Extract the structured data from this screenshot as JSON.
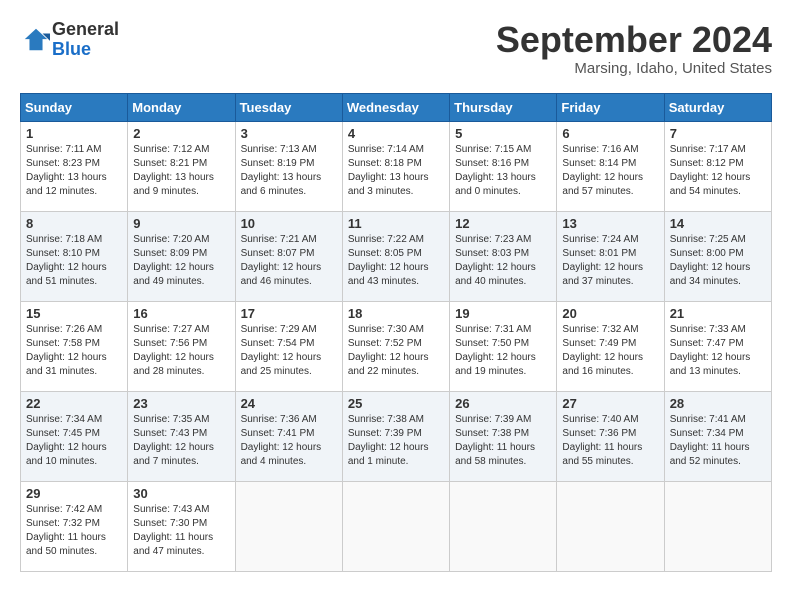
{
  "header": {
    "logo": {
      "line1": "General",
      "line2": "Blue"
    },
    "title": "September 2024",
    "location": "Marsing, Idaho, United States"
  },
  "days_of_week": [
    "Sunday",
    "Monday",
    "Tuesday",
    "Wednesday",
    "Thursday",
    "Friday",
    "Saturday"
  ],
  "weeks": [
    [
      {
        "day": 1,
        "sunrise": "7:11 AM",
        "sunset": "8:23 PM",
        "daylight": "13 hours and 12 minutes"
      },
      {
        "day": 2,
        "sunrise": "7:12 AM",
        "sunset": "8:21 PM",
        "daylight": "13 hours and 9 minutes"
      },
      {
        "day": 3,
        "sunrise": "7:13 AM",
        "sunset": "8:19 PM",
        "daylight": "13 hours and 6 minutes"
      },
      {
        "day": 4,
        "sunrise": "7:14 AM",
        "sunset": "8:18 PM",
        "daylight": "13 hours and 3 minutes"
      },
      {
        "day": 5,
        "sunrise": "7:15 AM",
        "sunset": "8:16 PM",
        "daylight": "13 hours and 0 minutes"
      },
      {
        "day": 6,
        "sunrise": "7:16 AM",
        "sunset": "8:14 PM",
        "daylight": "12 hours and 57 minutes"
      },
      {
        "day": 7,
        "sunrise": "7:17 AM",
        "sunset": "8:12 PM",
        "daylight": "12 hours and 54 minutes"
      }
    ],
    [
      {
        "day": 8,
        "sunrise": "7:18 AM",
        "sunset": "8:10 PM",
        "daylight": "12 hours and 51 minutes"
      },
      {
        "day": 9,
        "sunrise": "7:20 AM",
        "sunset": "8:09 PM",
        "daylight": "12 hours and 49 minutes"
      },
      {
        "day": 10,
        "sunrise": "7:21 AM",
        "sunset": "8:07 PM",
        "daylight": "12 hours and 46 minutes"
      },
      {
        "day": 11,
        "sunrise": "7:22 AM",
        "sunset": "8:05 PM",
        "daylight": "12 hours and 43 minutes"
      },
      {
        "day": 12,
        "sunrise": "7:23 AM",
        "sunset": "8:03 PM",
        "daylight": "12 hours and 40 minutes"
      },
      {
        "day": 13,
        "sunrise": "7:24 AM",
        "sunset": "8:01 PM",
        "daylight": "12 hours and 37 minutes"
      },
      {
        "day": 14,
        "sunrise": "7:25 AM",
        "sunset": "8:00 PM",
        "daylight": "12 hours and 34 minutes"
      }
    ],
    [
      {
        "day": 15,
        "sunrise": "7:26 AM",
        "sunset": "7:58 PM",
        "daylight": "12 hours and 31 minutes"
      },
      {
        "day": 16,
        "sunrise": "7:27 AM",
        "sunset": "7:56 PM",
        "daylight": "12 hours and 28 minutes"
      },
      {
        "day": 17,
        "sunrise": "7:29 AM",
        "sunset": "7:54 PM",
        "daylight": "12 hours and 25 minutes"
      },
      {
        "day": 18,
        "sunrise": "7:30 AM",
        "sunset": "7:52 PM",
        "daylight": "12 hours and 22 minutes"
      },
      {
        "day": 19,
        "sunrise": "7:31 AM",
        "sunset": "7:50 PM",
        "daylight": "12 hours and 19 minutes"
      },
      {
        "day": 20,
        "sunrise": "7:32 AM",
        "sunset": "7:49 PM",
        "daylight": "12 hours and 16 minutes"
      },
      {
        "day": 21,
        "sunrise": "7:33 AM",
        "sunset": "7:47 PM",
        "daylight": "12 hours and 13 minutes"
      }
    ],
    [
      {
        "day": 22,
        "sunrise": "7:34 AM",
        "sunset": "7:45 PM",
        "daylight": "12 hours and 10 minutes"
      },
      {
        "day": 23,
        "sunrise": "7:35 AM",
        "sunset": "7:43 PM",
        "daylight": "12 hours and 7 minutes"
      },
      {
        "day": 24,
        "sunrise": "7:36 AM",
        "sunset": "7:41 PM",
        "daylight": "12 hours and 4 minutes"
      },
      {
        "day": 25,
        "sunrise": "7:38 AM",
        "sunset": "7:39 PM",
        "daylight": "12 hours and 1 minute"
      },
      {
        "day": 26,
        "sunrise": "7:39 AM",
        "sunset": "7:38 PM",
        "daylight": "11 hours and 58 minutes"
      },
      {
        "day": 27,
        "sunrise": "7:40 AM",
        "sunset": "7:36 PM",
        "daylight": "11 hours and 55 minutes"
      },
      {
        "day": 28,
        "sunrise": "7:41 AM",
        "sunset": "7:34 PM",
        "daylight": "11 hours and 52 minutes"
      }
    ],
    [
      {
        "day": 29,
        "sunrise": "7:42 AM",
        "sunset": "7:32 PM",
        "daylight": "11 hours and 50 minutes"
      },
      {
        "day": 30,
        "sunrise": "7:43 AM",
        "sunset": "7:30 PM",
        "daylight": "11 hours and 47 minutes"
      },
      null,
      null,
      null,
      null,
      null
    ]
  ]
}
